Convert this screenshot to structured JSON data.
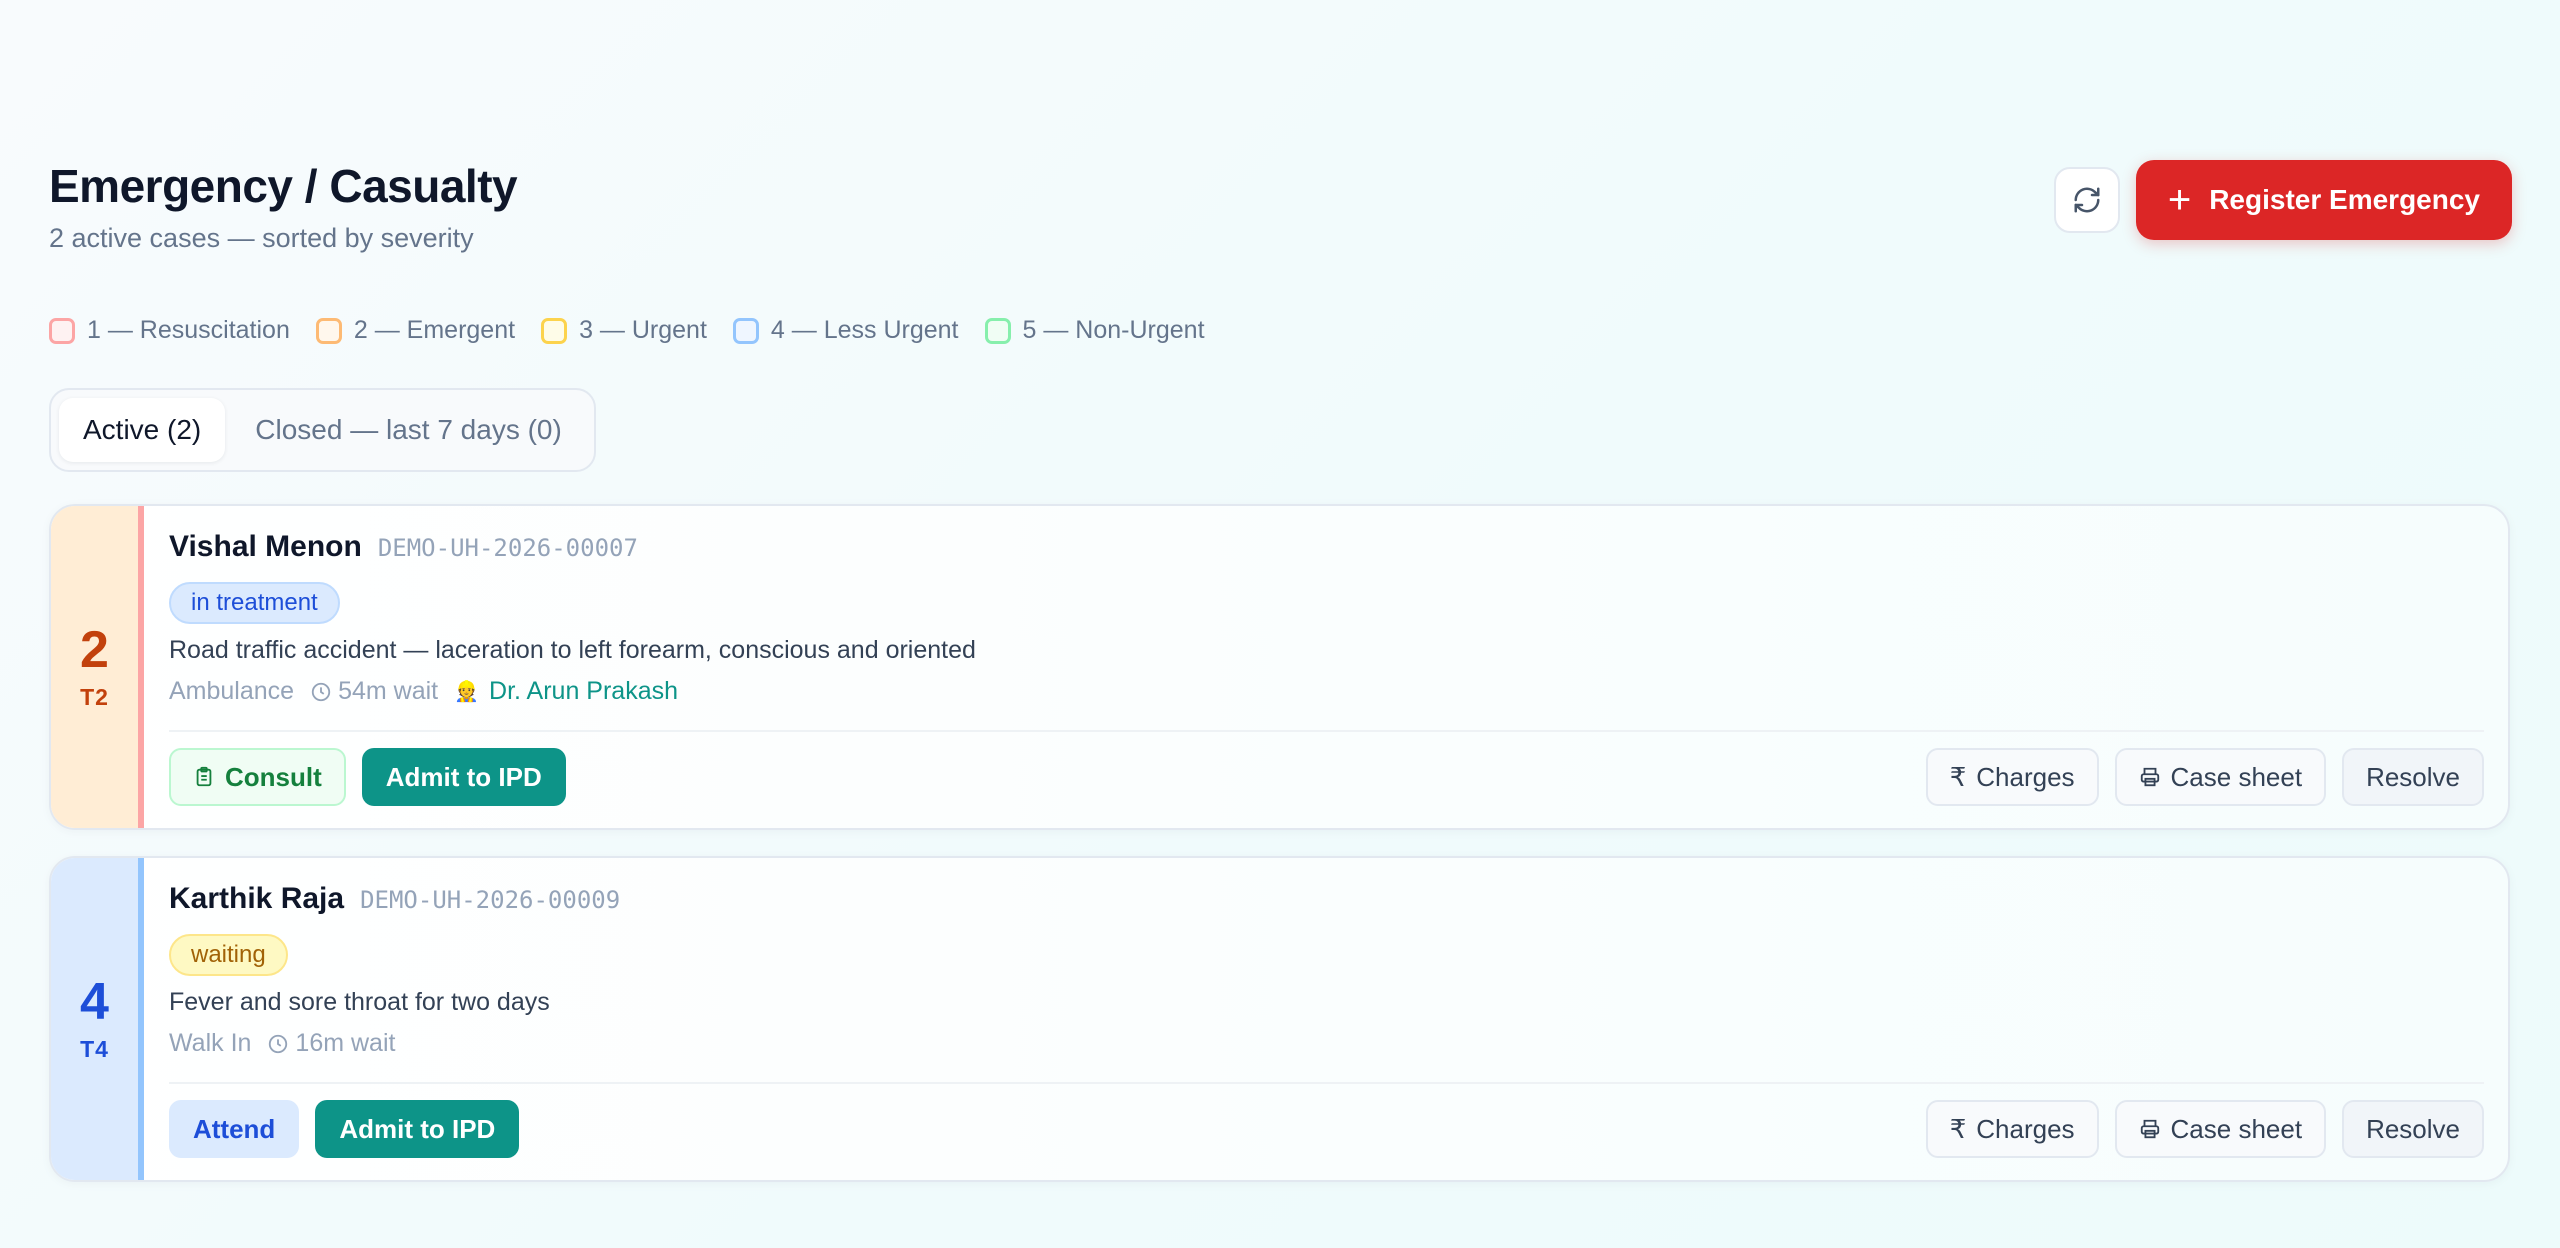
{
  "header": {
    "title": "Emergency / Casualty",
    "subtitle": "2 active cases — sorted by severity",
    "register_label": "Register Emergency",
    "register_icon": "plus-icon",
    "refresh_icon": "refresh-icon"
  },
  "legend": [
    {
      "label": "1 — Resuscitation",
      "color": "#fca5a5",
      "fill": "#fef2f2"
    },
    {
      "label": "2 — Emergent",
      "color": "#fdba74",
      "fill": "#fff7ed"
    },
    {
      "label": "3 — Urgent",
      "color": "#fcd34d",
      "fill": "#fefce8"
    },
    {
      "label": "4 — Less Urgent",
      "color": "#93c5fd",
      "fill": "#eff6ff"
    },
    {
      "label": "5 — Non-Urgent",
      "color": "#86efac",
      "fill": "#f0fdf4"
    }
  ],
  "tabs": [
    {
      "label": "Active (2)",
      "active": true
    },
    {
      "label": "Closed — last 7 days (0)",
      "active": false
    }
  ],
  "cases": [
    {
      "severity": "2",
      "triage": "T2",
      "severity_color": "#c2410c",
      "severity_bg": "#ffedd5",
      "severity_border": "#fca5a5",
      "name": "Vishal Menon",
      "id": "DEMO-UH-2026-00007",
      "status": "in treatment",
      "status_fg": "#1d4ed8",
      "status_bg": "#dbeafe",
      "status_border": "#bfdbfe",
      "complaint": "Road traffic accident — laceration to left forearm, conscious and oriented",
      "arrival": "Ambulance",
      "wait": "54m wait",
      "doctor": "Dr. Arun Prakash",
      "primary_action": "Consult",
      "admit_label": "Admit to IPD",
      "charges_label": "Charges",
      "case_sheet_label": "Case sheet",
      "resolve_label": "Resolve"
    },
    {
      "severity": "4",
      "triage": "T4",
      "severity_color": "#1d4ed8",
      "severity_bg": "#dbeafe",
      "severity_border": "#93c5fd",
      "name": "Karthik Raja",
      "id": "DEMO-UH-2026-00009",
      "status": "waiting",
      "status_fg": "#a16207",
      "status_bg": "#fef9c3",
      "status_border": "#fde68a",
      "complaint": "Fever and sore throat for two days",
      "arrival": "Walk In",
      "wait": "16m wait",
      "primary_action": "Attend",
      "admit_label": "Admit to IPD",
      "charges_label": "Charges",
      "case_sheet_label": "Case sheet",
      "resolve_label": "Resolve"
    }
  ]
}
